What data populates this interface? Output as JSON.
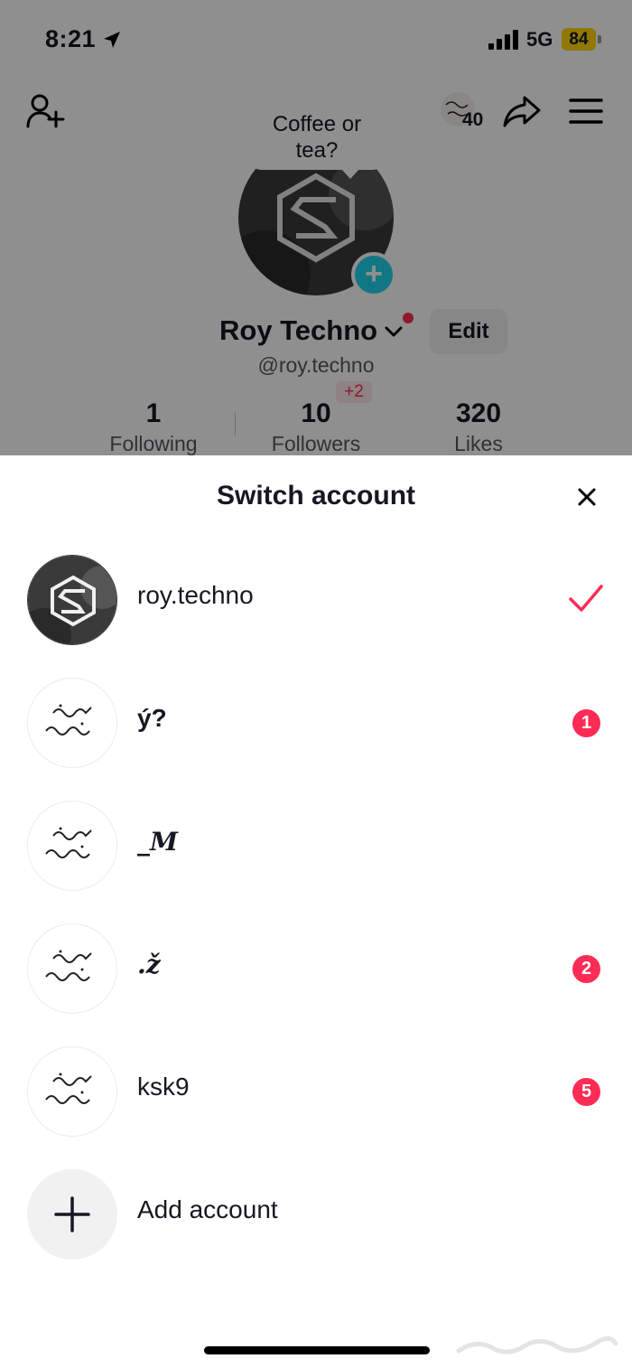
{
  "status_bar": {
    "time": "8:21",
    "network": "5G",
    "battery": "84",
    "battery_color": "#ffd60a"
  },
  "header": {
    "mini_avatar_count": "40"
  },
  "profile": {
    "bubble_text_line1": "Coffee or",
    "bubble_text_line2": "tea?",
    "display_name": "Roy Techno",
    "edit_label": "Edit",
    "handle": "@roy.techno",
    "new_followers": "+2",
    "stats": [
      {
        "value": "1",
        "label": "Following"
      },
      {
        "value": "10",
        "label": "Followers"
      },
      {
        "value": "320",
        "label": "Likes"
      }
    ]
  },
  "sheet": {
    "title": "Switch account",
    "accent_color": "#fe2c55",
    "accounts": [
      {
        "name": "roy.techno",
        "selected": true,
        "badge": ""
      },
      {
        "name": "ý?",
        "selected": false,
        "badge": "1"
      },
      {
        "name": "_𝑴",
        "selected": false,
        "badge": ""
      },
      {
        "name": ".ž",
        "selected": false,
        "badge": "2"
      },
      {
        "name": "ksk9",
        "selected": false,
        "badge": "5"
      }
    ],
    "add_account_label": "Add account"
  },
  "icons": [
    "location-arrow-icon",
    "signal-icon",
    "add-friend-icon",
    "share-icon",
    "menu-icon",
    "plus-icon",
    "chevron-down-icon",
    "close-icon",
    "checkmark-icon"
  ]
}
